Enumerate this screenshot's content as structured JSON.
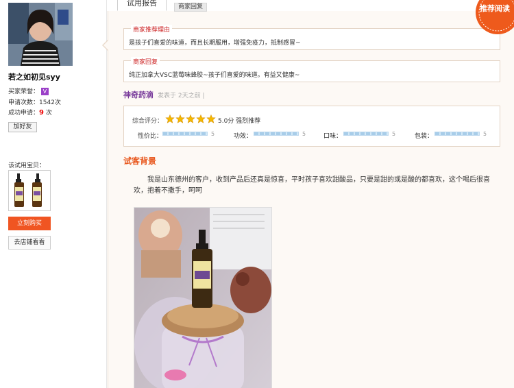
{
  "user": {
    "name": "若之如初见syy",
    "buyer_reputation_label": "买家荣誉：",
    "level_badge": "V",
    "apply_count_label": "申请次数：",
    "apply_count_value": "1542次",
    "success_label": "成功申请：",
    "success_value": "9",
    "success_unit": " 次",
    "add_friend_label": "加好友"
  },
  "product": {
    "trial_label": "该试用宝贝：",
    "buy_now_label": "立刻购买",
    "visit_shop_label": "去店铺看看"
  },
  "tabs": {
    "active": "试用报告",
    "inactive": "商家回复"
  },
  "merchant_reason": {
    "title": "商家推荐理由",
    "text": "是孩子们喜爱的味道，而且长期服用，增强免疫力，抵制感冒~"
  },
  "merchant_reply": {
    "title": "商家回复",
    "text": "纯正加拿大VSC蓝莓味蜂胶~孩子们喜爱的味道。有益又健康~"
  },
  "post": {
    "author": "神奇药滴",
    "posted": "发表于 2天之前  |"
  },
  "rating": {
    "overall_label": "综合评分：",
    "overall_stars": 5,
    "overall_score_text": "5.0分 强烈推荐",
    "subs": [
      {
        "label": "性价比：",
        "value": "5"
      },
      {
        "label": "功效：",
        "value": "5"
      },
      {
        "label": "口味：",
        "value": "5"
      },
      {
        "label": "包装：",
        "value": "5"
      }
    ]
  },
  "review": {
    "section_title": "试客背景",
    "text": "我是山东德州的客户，收到产品后还真是惊喜，平时孩子喜欢甜酸品，只要是甜的或是酸的都喜欢，这个喝后很喜欢，抱着不撒手，呵呵"
  },
  "seal": {
    "text": "推荐阅读"
  },
  "colors": {
    "accent_orange": "#f05522",
    "section_title": "#e8561c",
    "merchant_red": "#cc2222",
    "author_purple": "#7a3d9c",
    "star_gold": "#f5b800"
  }
}
